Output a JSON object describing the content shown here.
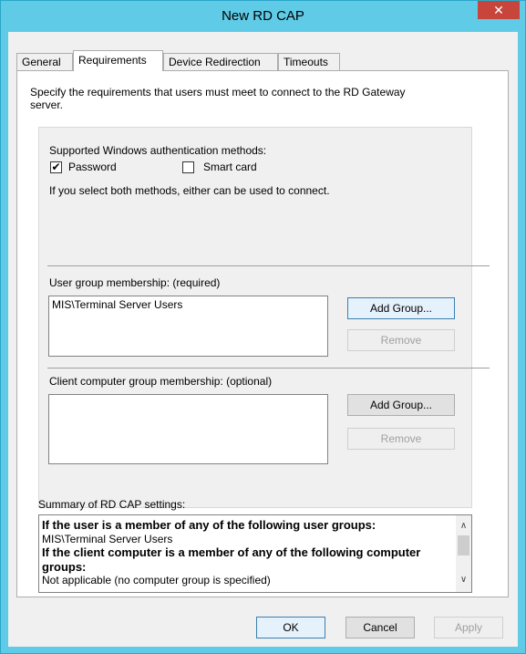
{
  "window": {
    "title": "New RD CAP",
    "close_glyph": "✕"
  },
  "tabs": [
    {
      "label": "General",
      "active": false
    },
    {
      "label": "Requirements",
      "active": true
    },
    {
      "label": "Device Redirection",
      "active": false
    },
    {
      "label": "Timeouts",
      "active": false
    }
  ],
  "requirements": {
    "intro": "Specify the requirements that users must meet to connect to the RD Gateway",
    "intro_line2": "server.",
    "auth_heading": "Supported Windows authentication methods:",
    "password_label": "Password",
    "password_checked": true,
    "check_glyph": "✔",
    "smartcard_label": "Smart card",
    "smartcard_checked": false,
    "both_note": "If you select both methods, either can be used to connect.",
    "user_group_heading": "User group membership: (required)",
    "user_groups": [
      "MIS\\Terminal Server Users"
    ],
    "add_group_label": "Add Group...",
    "remove_label": "Remove",
    "client_group_heading": "Client computer group membership: (optional)",
    "client_groups": [],
    "client_add_group_label": "Add Group...",
    "client_remove_label": "Remove"
  },
  "summary": {
    "heading": "Summary of RD CAP settings:",
    "line1": "If the user is a member of any of the following user groups:",
    "line2": "MIS\\Terminal Server Users",
    "line3": "If the client computer is a member of any of the following computer",
    "line4": "groups:",
    "line5": "Not applicable (no computer group is specified)",
    "scroll_up_glyph": "∧",
    "scroll_down_glyph": "∨"
  },
  "buttons": {
    "ok": "OK",
    "cancel": "Cancel",
    "apply": "Apply"
  }
}
